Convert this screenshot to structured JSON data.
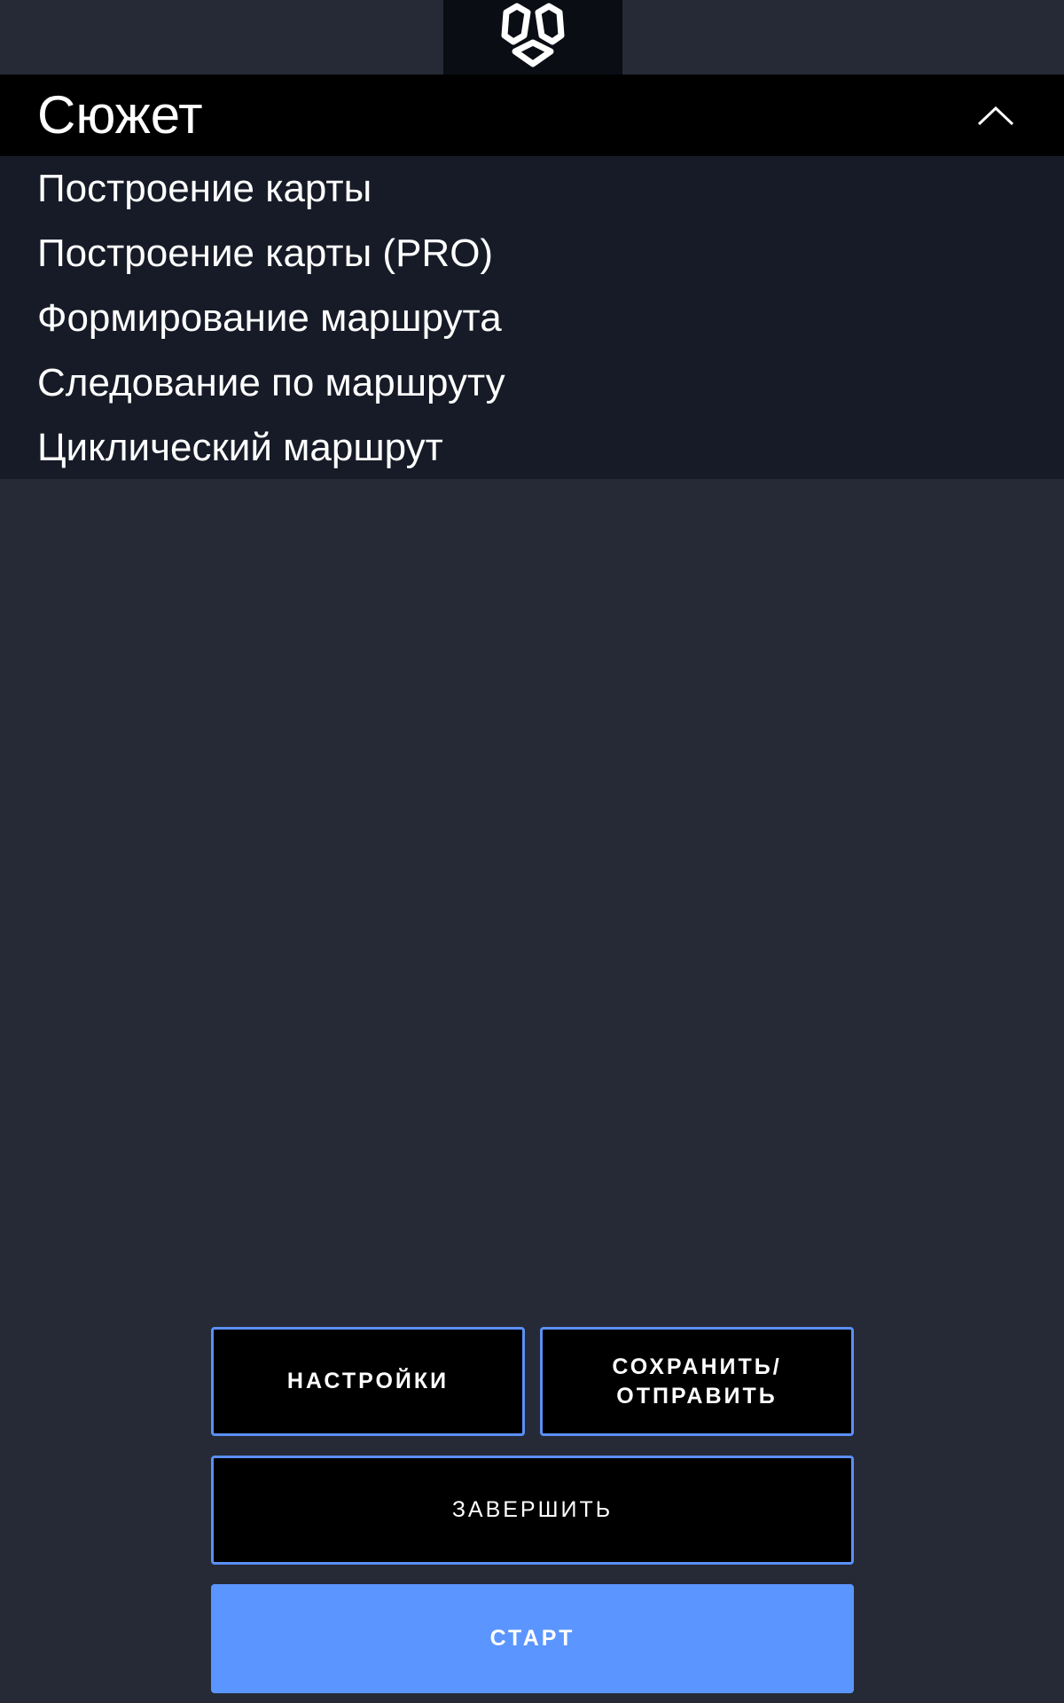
{
  "logo": {
    "icon": "hexagon-logo-icon"
  },
  "dropdown": {
    "title": "Сюжет",
    "expanded": true,
    "chevron_icon": "chevron-up-icon",
    "items": [
      {
        "label": "Построение карты"
      },
      {
        "label": "Построение карты (PRO)"
      },
      {
        "label": "Формирование маршрута"
      },
      {
        "label": "Следование по маршруту"
      },
      {
        "label": "Циклический маршрут"
      }
    ]
  },
  "buttons": {
    "settings_label": "НАСТРОЙКИ",
    "save_label_line1": "СОХРАНИТЬ/",
    "save_label_line2": "ОТПРАВИТЬ",
    "finish_label": "ЗАВЕРШИТЬ",
    "start_label": "СТАРТ"
  },
  "colors": {
    "background": "#252a36",
    "header_bg": "#000000",
    "list_bg": "#171b27",
    "accent": "#5b95ff",
    "button_border": "#5b8ff5"
  }
}
